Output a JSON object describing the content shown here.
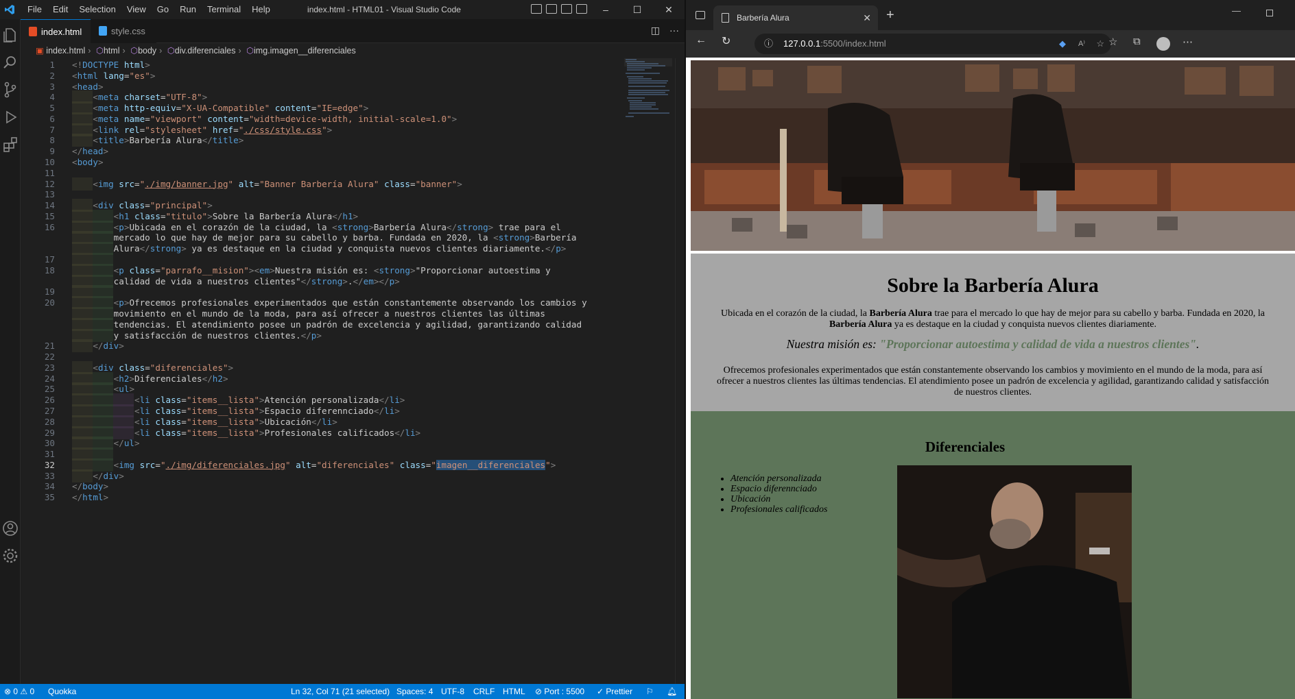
{
  "vscode": {
    "window_title": "index.html - HTML01 - Visual Studio Code",
    "menu": [
      "File",
      "Edit",
      "Selection",
      "View",
      "Go",
      "Run",
      "Terminal",
      "Help"
    ],
    "tabs": [
      {
        "label": "index.html",
        "active": true
      },
      {
        "label": "style.css",
        "active": false
      }
    ],
    "breadcrumb": [
      "index.html",
      "html",
      "body",
      "div.diferenciales",
      "img.imagen__diferenciales"
    ],
    "current_line": 32,
    "code_lines": [
      {
        "n": "1",
        "html": "<span class='t'>&lt;!</span><span class='tn'>DOCTYPE</span> <span class='at'>html</span><span class='t'>&gt;</span>"
      },
      {
        "n": "2",
        "html": "<span class='t'>&lt;</span><span class='tn'>html</span> <span class='at'>lang</span>=<span class='av'>\"es\"</span><span class='t'>&gt;</span>"
      },
      {
        "n": "3",
        "html": "<span class='t'>&lt;</span><span class='tn'>head</span><span class='t'>&gt;</span>"
      },
      {
        "n": "4",
        "ind": 1,
        "html": "    <span class='t'>&lt;</span><span class='tn'>meta</span> <span class='at'>charset</span>=<span class='av'>\"UTF-8\"</span><span class='t'>&gt;</span>"
      },
      {
        "n": "5",
        "ind": 1,
        "html": "    <span class='t'>&lt;</span><span class='tn'>meta</span> <span class='at'>http-equiv</span>=<span class='av'>\"X-UA-Compatible\"</span> <span class='at'>content</span>=<span class='av'>\"IE=edge\"</span><span class='t'>&gt;</span>"
      },
      {
        "n": "6",
        "ind": 1,
        "html": "    <span class='t'>&lt;</span><span class='tn'>meta</span> <span class='at'>name</span>=<span class='av'>\"viewport\"</span> <span class='at'>content</span>=<span class='av'>\"width=device-width, initial-scale=1.0\"</span><span class='t'>&gt;</span>"
      },
      {
        "n": "7",
        "ind": 1,
        "html": "    <span class='t'>&lt;</span><span class='tn'>link</span> <span class='at'>rel</span>=<span class='av'>\"stylesheet\"</span> <span class='at'>href</span>=<span class='av'>\"<span class='ul'>./css/style.css</span>\"</span><span class='t'>&gt;</span>"
      },
      {
        "n": "8",
        "ind": 1,
        "html": "    <span class='t'>&lt;</span><span class='tn'>title</span><span class='t'>&gt;</span>Barbería Alura<span class='t'>&lt;/</span><span class='tn'>title</span><span class='t'>&gt;</span>"
      },
      {
        "n": "9",
        "html": "<span class='t'>&lt;/</span><span class='tn'>head</span><span class='t'>&gt;</span>"
      },
      {
        "n": "10",
        "html": "<span class='t'>&lt;</span><span class='tn'>body</span><span class='t'>&gt;</span>"
      },
      {
        "n": "11",
        "html": ""
      },
      {
        "n": "12",
        "ind": 1,
        "html": "    <span class='t'>&lt;</span><span class='tn'>img</span> <span class='at'>src</span>=<span class='av'>\"<span class='ul'>./img/banner.jpg</span>\"</span> <span class='at'>alt</span>=<span class='av'>\"Banner Barbería Alura\"</span> <span class='at'>class</span>=<span class='av'>\"banner\"</span><span class='t'>&gt;</span>"
      },
      {
        "n": "13",
        "html": ""
      },
      {
        "n": "14",
        "ind": 1,
        "html": "    <span class='t'>&lt;</span><span class='tn'>div</span> <span class='at'>class</span>=<span class='av'>\"principal\"</span><span class='t'>&gt;</span>"
      },
      {
        "n": "15",
        "ind": 2,
        "html": "        <span class='t'>&lt;</span><span class='tn'>h1</span> <span class='at'>class</span>=<span class='av'>\"titulo\"</span><span class='t'>&gt;</span>Sobre la Barbería Alura<span class='t'>&lt;/</span><span class='tn'>h1</span><span class='t'>&gt;</span>"
      },
      {
        "n": "16",
        "ind": 2,
        "html": "        <span class='t'>&lt;</span><span class='tn'>p</span><span class='t'>&gt;</span>Ubicada en el corazón de la ciudad, la <span class='t'>&lt;</span><span class='tn'>strong</span><span class='t'>&gt;</span>Barbería Alura<span class='t'>&lt;/</span><span class='tn'>strong</span><span class='t'>&gt;</span> trae para el"
      },
      {
        "n": "",
        "ind": 2,
        "html": "        mercado lo que hay de mejor para su cabello y barba. Fundada en 2020, la <span class='t'>&lt;</span><span class='tn'>strong</span><span class='t'>&gt;</span>Barbería"
      },
      {
        "n": "",
        "ind": 2,
        "html": "        Alura<span class='t'>&lt;/</span><span class='tn'>strong</span><span class='t'>&gt;</span> ya es destaque en la ciudad y conquista nuevos clientes diariamente.<span class='t'>&lt;/</span><span class='tn'>p</span><span class='t'>&gt;</span>"
      },
      {
        "n": "17",
        "ind": 2,
        "html": ""
      },
      {
        "n": "18",
        "ind": 2,
        "html": "        <span class='t'>&lt;</span><span class='tn'>p</span> <span class='at'>class</span>=<span class='av'>\"parrafo__mision\"</span><span class='t'>&gt;&lt;</span><span class='tn'>em</span><span class='t'>&gt;</span>Nuestra misión es: <span class='t'>&lt;</span><span class='tn'>strong</span><span class='t'>&gt;</span>\"Proporcionar autoestima y"
      },
      {
        "n": "",
        "ind": 2,
        "html": "        calidad de vida a nuestros clientes\"<span class='t'>&lt;/</span><span class='tn'>strong</span><span class='t'>&gt;</span>.<span class='t'>&lt;/</span><span class='tn'>em</span><span class='t'>&gt;&lt;/</span><span class='tn'>p</span><span class='t'>&gt;</span>"
      },
      {
        "n": "19",
        "ind": 2,
        "html": ""
      },
      {
        "n": "20",
        "ind": 2,
        "html": "        <span class='t'>&lt;</span><span class='tn'>p</span><span class='t'>&gt;</span>Ofrecemos profesionales experimentados que están constantemente observando los cambios y"
      },
      {
        "n": "",
        "ind": 2,
        "html": "        movimiento en el mundo de la moda, para así ofrecer a nuestros clientes las últimas"
      },
      {
        "n": "",
        "ind": 2,
        "html": "        tendencias. El atendimiento posee un padrón de excelencia y agilidad, garantizando calidad"
      },
      {
        "n": "",
        "ind": 2,
        "html": "        y satisfacción de nuestros clientes.<span class='t'>&lt;/</span><span class='tn'>p</span><span class='t'>&gt;</span>"
      },
      {
        "n": "21",
        "ind": 1,
        "html": "    <span class='t'>&lt;/</span><span class='tn'>div</span><span class='t'>&gt;</span>"
      },
      {
        "n": "22",
        "html": ""
      },
      {
        "n": "23",
        "ind": 1,
        "html": "    <span class='t'>&lt;</span><span class='tn'>div</span> <span class='at'>class</span>=<span class='av'>\"diferenciales\"</span><span class='t'>&gt;</span>"
      },
      {
        "n": "24",
        "ind": 2,
        "html": "        <span class='t'>&lt;</span><span class='tn'>h2</span><span class='t'>&gt;</span>Diferenciales<span class='t'>&lt;/</span><span class='tn'>h2</span><span class='t'>&gt;</span>"
      },
      {
        "n": "25",
        "ind": 2,
        "html": "        <span class='t'>&lt;</span><span class='tn'>ul</span><span class='t'>&gt;</span>"
      },
      {
        "n": "26",
        "ind": 3,
        "html": "            <span class='t'>&lt;</span><span class='tn'>li</span> <span class='at'>class</span>=<span class='av'>\"items__lista\"</span><span class='t'>&gt;</span>Atención personalizada<span class='t'>&lt;/</span><span class='tn'>li</span><span class='t'>&gt;</span>"
      },
      {
        "n": "27",
        "ind": 3,
        "html": "            <span class='t'>&lt;</span><span class='tn'>li</span> <span class='at'>class</span>=<span class='av'>\"items__lista\"</span><span class='t'>&gt;</span>Espacio diferennciado<span class='t'>&lt;/</span><span class='tn'>li</span><span class='t'>&gt;</span>"
      },
      {
        "n": "28",
        "ind": 3,
        "html": "            <span class='t'>&lt;</span><span class='tn'>li</span> <span class='at'>class</span>=<span class='av'>\"items__lista\"</span><span class='t'>&gt;</span>Ubicación<span class='t'>&lt;/</span><span class='tn'>li</span><span class='t'>&gt;</span>"
      },
      {
        "n": "29",
        "ind": 3,
        "html": "            <span class='t'>&lt;</span><span class='tn'>li</span> <span class='at'>class</span>=<span class='av'>\"items__lista\"</span><span class='t'>&gt;</span>Profesionales calificados<span class='t'>&lt;/</span><span class='tn'>li</span><span class='t'>&gt;</span>"
      },
      {
        "n": "30",
        "ind": 2,
        "html": "        <span class='t'>&lt;/</span><span class='tn'>ul</span><span class='t'>&gt;</span>"
      },
      {
        "n": "31",
        "ind": 2,
        "html": ""
      },
      {
        "n": "32",
        "ind": 2,
        "html": "        <span class='t'>&lt;</span><span class='tn'>img</span> <span class='at'>src</span>=<span class='av'>\"<span class='ul'>./img/diferenciales.jpg</span>\"</span> <span class='at'>alt</span>=<span class='av'>\"diferenciales\"</span> <span class='at'>class</span>=<span class='av'>\"<span class='sel'>imagen__diferenciales</span>\"</span><span class='t'>&gt;</span>"
      },
      {
        "n": "33",
        "ind": 1,
        "html": "    <span class='t'>&lt;/</span><span class='tn'>div</span><span class='t'>&gt;</span>"
      },
      {
        "n": "34",
        "html": "<span class='t'>&lt;/</span><span class='tn'>body</span><span class='t'>&gt;</span>"
      },
      {
        "n": "35",
        "html": "<span class='t'>&lt;/</span><span class='tn'>html</span><span class='t'>&gt;</span>"
      }
    ],
    "status": {
      "problems": "⊗ 0 ⚠ 0",
      "quokka": "Quokka",
      "position": "Ln 32, Col 71 (21 selected)",
      "spaces": "Spaces: 4",
      "encoding": "UTF-8",
      "eol": "CRLF",
      "language": "HTML",
      "port": "⊘ Port : 5500",
      "prettier": "✓ Prettier"
    },
    "colors": {
      "statusbar": "#0078d4",
      "editor_bg": "#1f1f1f"
    }
  },
  "browser": {
    "tab_title": "Barbería Alura",
    "url_host": "127.0.0.1",
    "url_rest": ":5500/index.html",
    "page": {
      "title": "Sobre la Barbería Alura",
      "p1_a": "Ubicada en el corazón de la ciudad, la ",
      "p1_strong1": "Barbería Alura",
      "p1_b": " trae para el mercado lo que hay de mejor para su cabello y barba. Fundada en 2020, la ",
      "p1_strong2": "Barbería Alura",
      "p1_c": " ya es destaque en la ciudad y conquista nuevos clientes diariamente.",
      "mision_em": "Nuestra misión es: ",
      "mision_strong": "\"Proporcionar autoestima y calidad de vida a nuestros clientes\"",
      "mision_end": ".",
      "p2": "Ofrecemos profesionales experimentados que están constantemente observando los cambios y movimiento en el mundo de la moda, para así ofrecer a nuestros clientes las últimas tendencias. El atendimiento posee un padrón de excelencia y agilidad, garantizando calidad y satisfacción de nuestros clientes.",
      "diferenciales_title": "Diferenciales",
      "diferenciales_items": [
        "Atención personalizada",
        "Espacio diferennciado",
        "Ubicación",
        "Profesionales calificados"
      ],
      "colors": {
        "principal_bg": "#a6a6a6",
        "diferenciales_bg": "#5d7559"
      }
    }
  }
}
